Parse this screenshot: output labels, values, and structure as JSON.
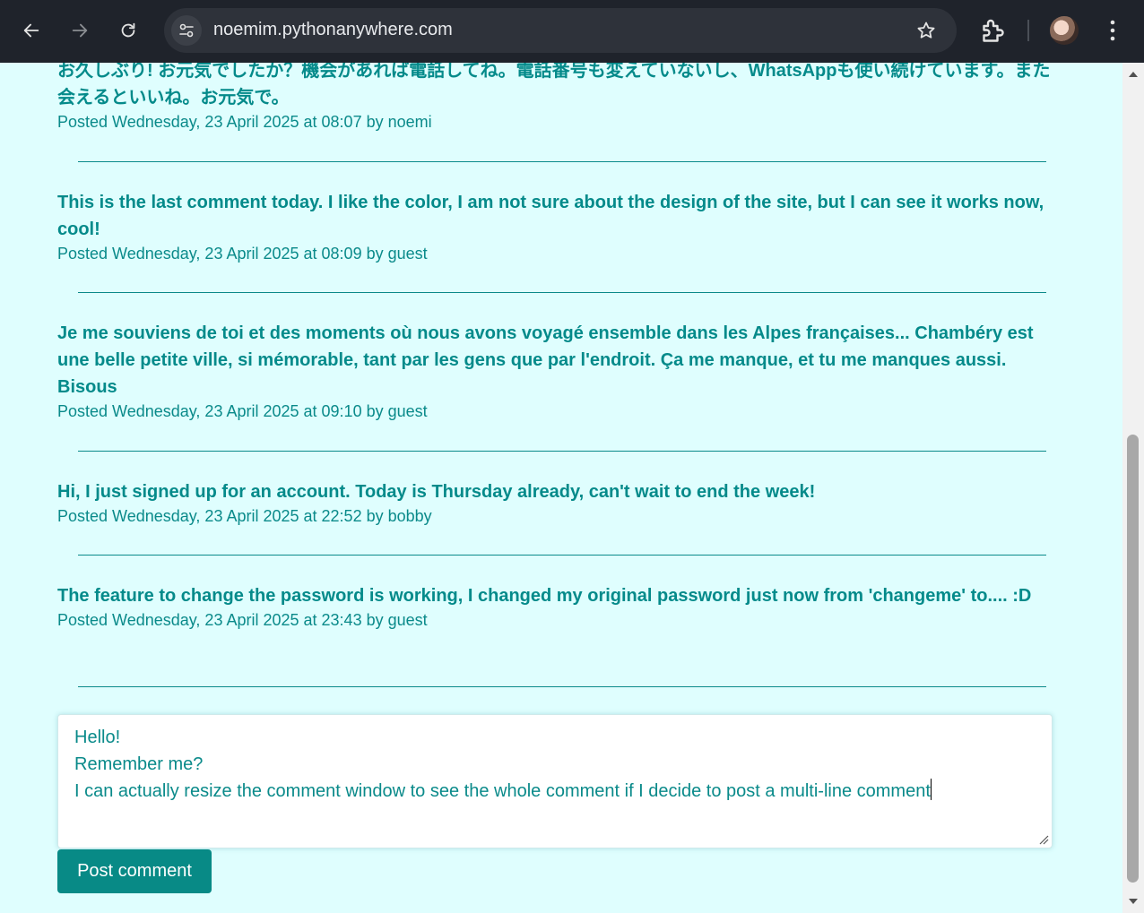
{
  "browser": {
    "url": "noemim.pythonanywhere.com"
  },
  "posts": [
    {
      "text": "お久しぶり! お元気でしたか？機会があれば電話してね。電話番号も変えていないし、WhatsAppも使い続けています。また会えるといいね。お元気で。",
      "meta": "Posted Wednesday, 23 April 2025 at 08:07 by noemi"
    },
    {
      "text": "This is the last comment today. I like the color, I am not sure about the design of the site, but I can see it works now, cool!",
      "meta": "Posted Wednesday, 23 April 2025 at 08:09 by guest"
    },
    {
      "text": "Je me souviens de toi et des moments où nous avons voyagé ensemble dans les Alpes françaises... Chambéry est une belle petite ville, si mémorable, tant par les gens que par l'endroit. Ça me manque, et tu me manques aussi. Bisous",
      "meta": "Posted Wednesday, 23 April 2025 at 09:10 by guest"
    },
    {
      "text": "Hi, I just signed up for an account. Today is Thursday already, can't wait to end the week!",
      "meta": "Posted Wednesday, 23 April 2025 at 22:52 by bobby"
    },
    {
      "text": "The feature to change the password is working, I changed my original password just now from 'changeme' to.... :D",
      "meta": "Posted Wednesday, 23 April 2025 at 23:43 by guest"
    }
  ],
  "comment": {
    "lines": [
      "Hello!",
      "Remember me?",
      "I can actually resize the comment window to see the whole comment if I decide to post a multi-line comment"
    ],
    "button_label": "Post comment"
  },
  "colors": {
    "accent": "#088a86",
    "page_bg": "#dffefe",
    "text": "#048a8a"
  },
  "icons": [
    "back-arrow-icon",
    "forward-arrow-icon",
    "reload-icon",
    "site-info-icon",
    "bookmark-star-icon",
    "extensions-icon",
    "profile-avatar",
    "more-menu-icon",
    "resize-handle-icon"
  ]
}
